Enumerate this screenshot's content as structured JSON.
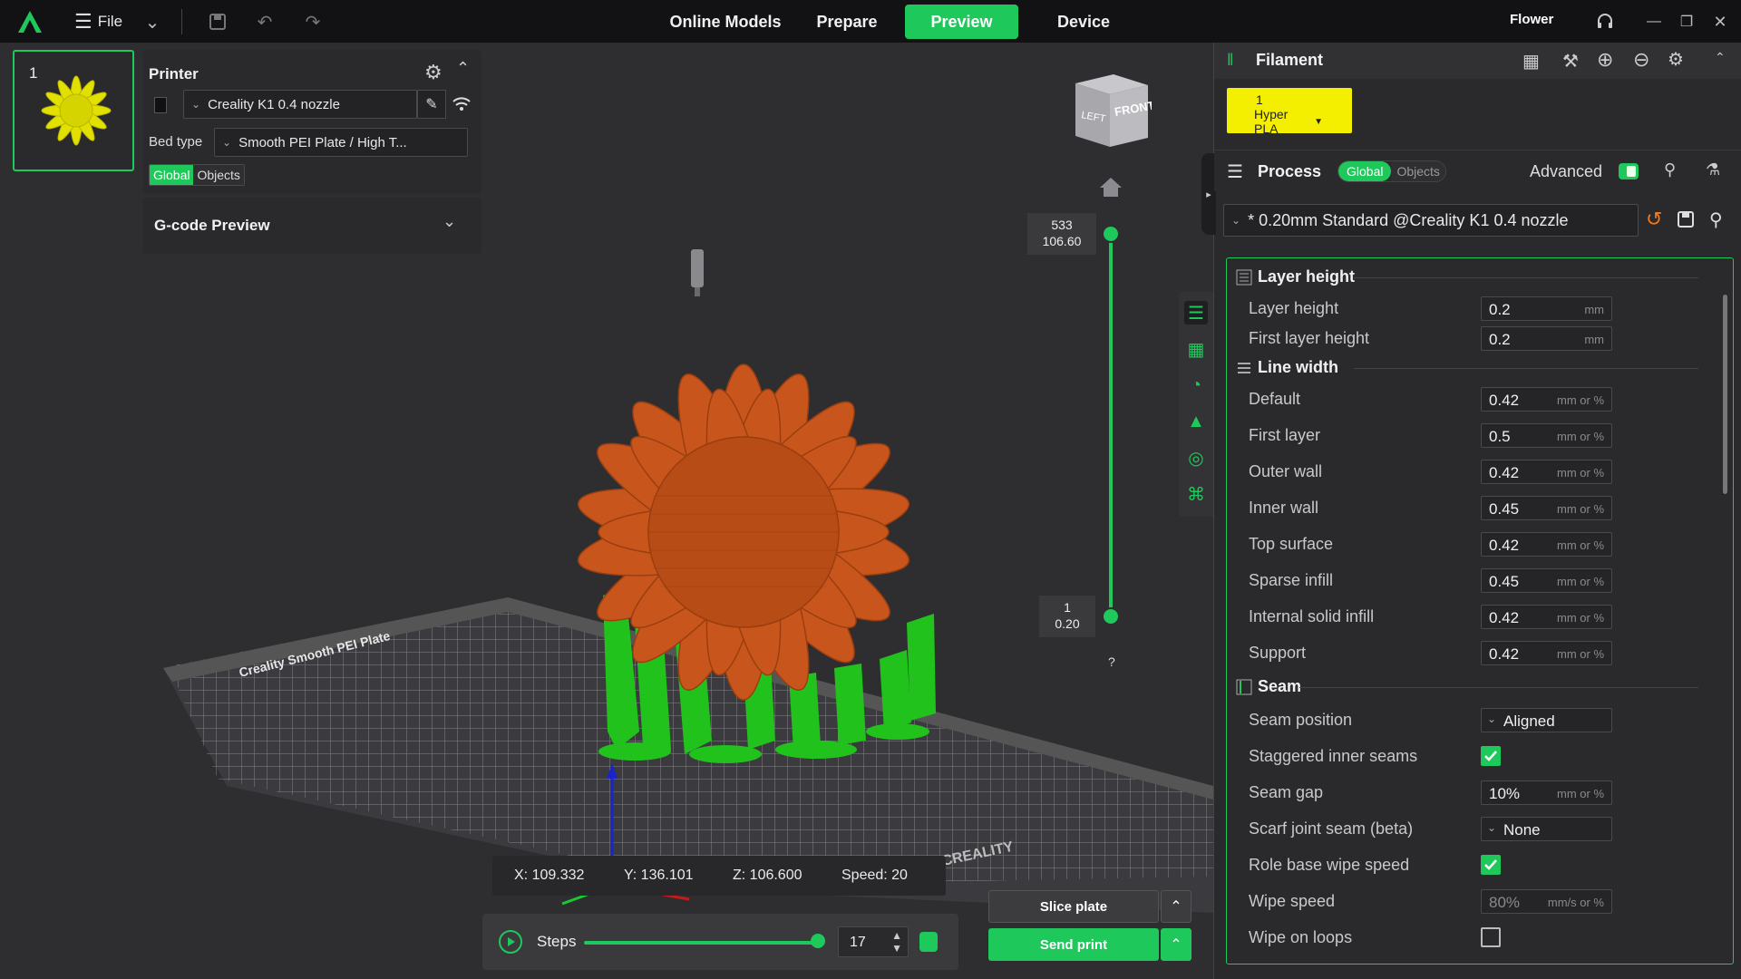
{
  "topbar": {
    "file_label": "File",
    "tabs": [
      {
        "label": "Online Models"
      },
      {
        "label": "Prepare"
      },
      {
        "label": "Preview"
      },
      {
        "label": "Device"
      }
    ],
    "project_name": "Flower"
  },
  "plate": {
    "number": "1"
  },
  "printer_panel": {
    "title": "Printer",
    "printer_name": "Creality K1 0.4 nozzle",
    "bed_label": "Bed type",
    "bed_value": "Smooth PEI Plate / High T...",
    "scope_global": "Global",
    "scope_objects": "Objects"
  },
  "gcode_panel": {
    "title": "G-code Preview"
  },
  "layer_slider": {
    "top_layer": "533",
    "top_height": "106.60",
    "bottom_layer": "1",
    "bottom_height": "0.20",
    "help": "?"
  },
  "cube": {
    "left": "LEFT",
    "front": "FRONT"
  },
  "coords": {
    "x": "X: 109.332",
    "y": "Y: 136.101",
    "z": "Z: 106.600",
    "speed": "Speed: 20"
  },
  "steps": {
    "label": "Steps",
    "value": "17",
    "progress": 1.0
  },
  "actions": {
    "slice": "Slice plate",
    "send": "Send print"
  },
  "filament": {
    "title": "Filament",
    "slot_number": "1",
    "slot_name": "Hyper PLA",
    "slot_color": "#f4ef00"
  },
  "process": {
    "title": "Process",
    "scope_global": "Global",
    "scope_objects": "Objects",
    "advanced_label": "Advanced",
    "advanced_on": true,
    "profile": "* 0.20mm Standard @Creality K1 0.4 nozzle"
  },
  "sections": {
    "layer_height": "Layer height",
    "line_width": "Line width",
    "seam": "Seam"
  },
  "params": {
    "layer_height": {
      "label": "Layer height",
      "value": "0.2",
      "unit": "mm"
    },
    "first_layer_height": {
      "label": "First layer height",
      "value": "0.2",
      "unit": "mm"
    },
    "lw_default": {
      "label": "Default",
      "value": "0.42",
      "unit": "mm or %"
    },
    "lw_first_layer": {
      "label": "First layer",
      "value": "0.5",
      "unit": "mm or %"
    },
    "lw_outer_wall": {
      "label": "Outer wall",
      "value": "0.42",
      "unit": "mm or %"
    },
    "lw_inner_wall": {
      "label": "Inner wall",
      "value": "0.45",
      "unit": "mm or %"
    },
    "lw_top_surface": {
      "label": "Top surface",
      "value": "0.42",
      "unit": "mm or %"
    },
    "lw_sparse_infill": {
      "label": "Sparse infill",
      "value": "0.45",
      "unit": "mm or %"
    },
    "lw_internal_solid": {
      "label": "Internal solid infill",
      "value": "0.42",
      "unit": "mm or %"
    },
    "lw_support": {
      "label": "Support",
      "value": "0.42",
      "unit": "mm or %"
    },
    "seam_position": {
      "label": "Seam position",
      "value": "Aligned"
    },
    "staggered": {
      "label": "Staggered inner seams",
      "checked": true
    },
    "seam_gap": {
      "label": "Seam gap",
      "value": "10%",
      "unit": "mm or %"
    },
    "scarf": {
      "label": "Scarf joint seam (beta)",
      "value": "None"
    },
    "role_wipe": {
      "label": "Role base wipe speed",
      "checked": true
    },
    "wipe_speed": {
      "label": "Wipe speed",
      "value": "80%",
      "unit": "mm/s or %"
    },
    "wipe_loops": {
      "label": "Wipe on loops",
      "checked": false
    }
  },
  "colors": {
    "accent": "#1ec85a",
    "model": "#c8561c",
    "support": "#22c21c",
    "background": "#2e2e31"
  },
  "icons": [
    "app-logo-icon",
    "menu-icon",
    "save-icon",
    "undo-icon",
    "redo-icon",
    "gear-icon",
    "wifi-icon",
    "edit-icon",
    "home-icon",
    "play-icon",
    "search-icon"
  ]
}
